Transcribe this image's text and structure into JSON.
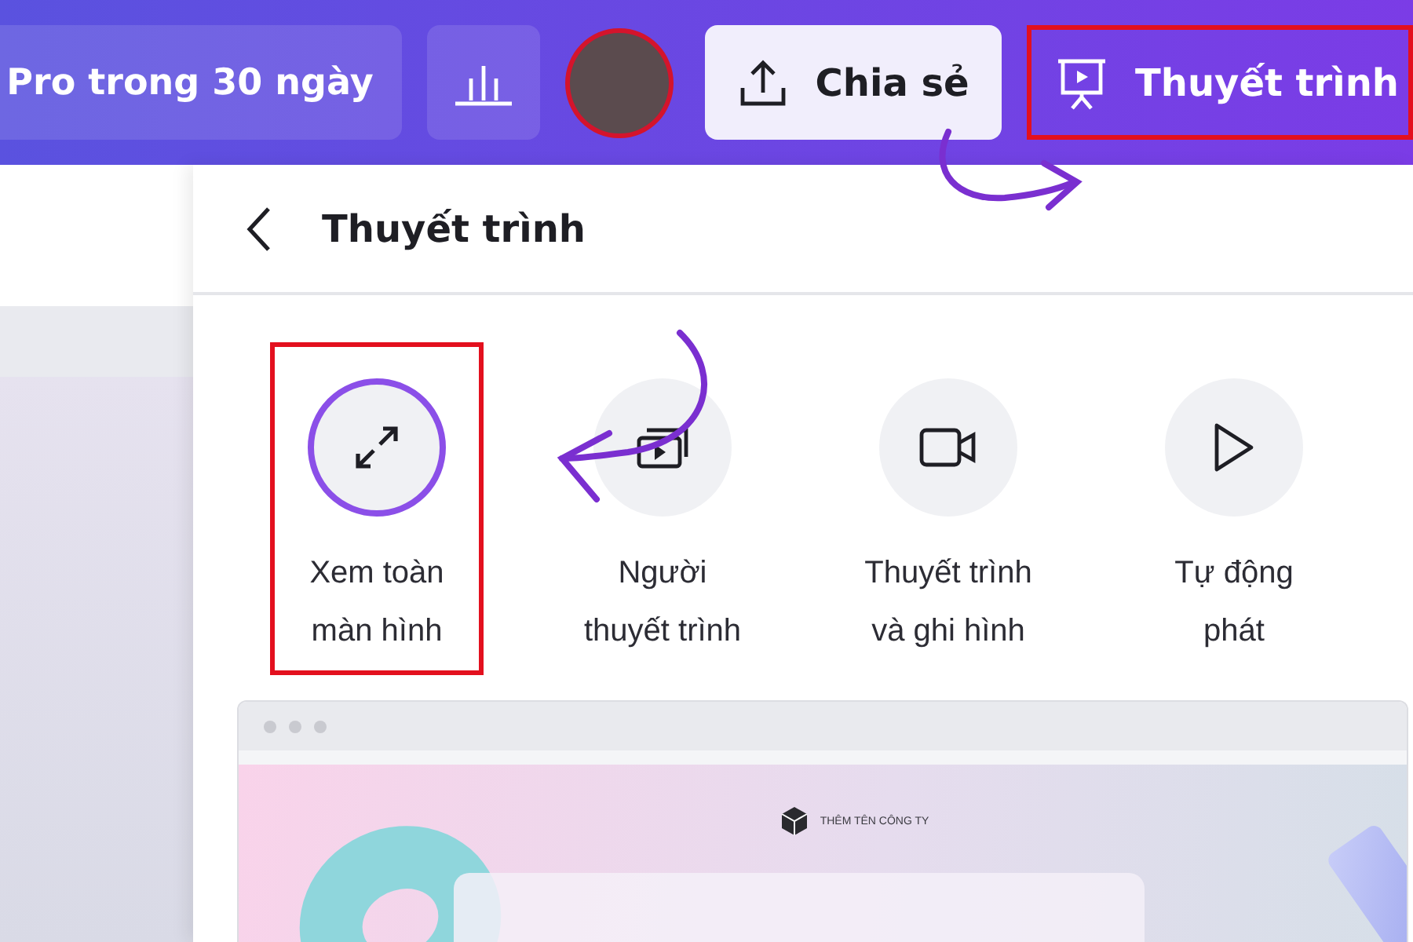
{
  "top_bar": {
    "trial_button": "Pro trong 30 ngày",
    "share_button": "Chia sẻ",
    "present_button": {
      "label": "Thuyết trình",
      "highlighted": true
    }
  },
  "panel": {
    "title": "Thuyết trình",
    "options": [
      {
        "label": "Xem toàn\nmàn hình",
        "kind": "fullscreen",
        "selected": true
      },
      {
        "label": "Người\nthuyết trình",
        "kind": "presenter",
        "selected": false
      },
      {
        "label": "Thuyết trình\nvà ghi hình",
        "kind": "record",
        "selected": false
      },
      {
        "label": "Tự động\nphát",
        "kind": "autoplay",
        "selected": false
      }
    ],
    "preview": {
      "company_name": "THÊM TÊN CÔNG TY"
    }
  }
}
